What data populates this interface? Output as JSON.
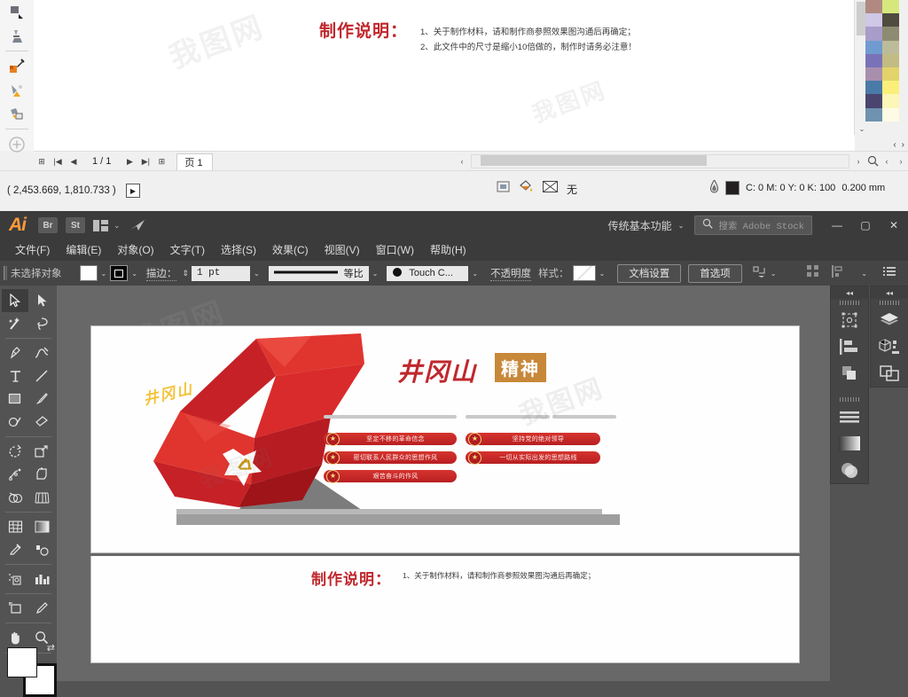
{
  "corel": {
    "toolbox": [
      {
        "name": "shadow-tool",
        "label": "阴影工具"
      },
      {
        "name": "transparency-tool",
        "label": "透明度工具"
      },
      {
        "name": "color-eyedropper-tool",
        "label": "颜色滴管工具"
      },
      {
        "name": "interactive-fill-tool",
        "label": "交互式填充工具"
      },
      {
        "name": "smart-fill-tool",
        "label": "智能填充工具"
      },
      {
        "name": "add-tool-icon",
        "label": "添加工具"
      }
    ],
    "document_note": {
      "title": "制作说明：",
      "line1": "1、关于制作材料，请和制作商参照效果图沟通后再确定；",
      "line2": "2、此文件中的尺寸是缩小10倍做的，制作时请务必注意！"
    },
    "page_nav": {
      "add_page_start": "add-page-icon",
      "first": "first-page-icon",
      "prev": "prev-page-icon",
      "counter": "1 / 1",
      "next": "next-page-icon",
      "last": "last-page-icon",
      "add_page_end": "add-page-icon",
      "tab_label": "页 1"
    },
    "status": {
      "coords": "( 2,453.669, 1,810.733 )",
      "coords_button": "expand-coords-icon",
      "fill_none_label": "无",
      "outline_color": "C: 0 M: 0 Y: 0 K: 100",
      "outline_width": "0.200 mm",
      "outline_swatch_hex": "#231f20"
    },
    "palette": {
      "col1": [
        "#b08a80",
        "#cfc8e6",
        "#a89cc8",
        "#6f9bd1",
        "#7a72b8",
        "#a98fae",
        "#4a7aa8",
        "#49456e",
        "#6f92ae"
      ],
      "col2": [
        "#d6e87d",
        "#4f4b3e",
        "#8d8c72",
        "#bdbc9a",
        "#c2bb84",
        "#e3d36a",
        "#fbef7a",
        "#fdf6b8",
        "#fdfbe4"
      ]
    }
  },
  "ai": {
    "title_bar": {
      "logo": "Ai",
      "bridge": "Br",
      "stock": "St",
      "arrange_icon": "arrange-documents-icon",
      "chevron": "chevron-down-icon",
      "cc_icon": "creative-cloud-icon",
      "workspace": "传统基本功能",
      "search_placeholder": "搜索 Adobe Stock",
      "minimize": "—",
      "maximize": "▢",
      "close": "✕"
    },
    "menus": [
      "文件(F)",
      "编辑(E)",
      "对象(O)",
      "文字(T)",
      "选择(S)",
      "效果(C)",
      "视图(V)",
      "窗口(W)",
      "帮助(H)"
    ],
    "control_bar": {
      "selection_label": "未选择对象",
      "fill_swatch_hex": "#ffffff",
      "stroke_label": "描边：",
      "stroke_weight": "1 pt",
      "stroke_profile": "等比",
      "brush_label": "Touch C...",
      "opacity_label": "不透明度",
      "style_label": "样式：",
      "document_setup": "文档设置",
      "preferences": "首选项",
      "align_icon": "align-icon",
      "transform_icon": "transform-icon",
      "menu_icon": "panel-menu-icon"
    },
    "tools": [
      {
        "name": "selection-tool",
        "selected": true
      },
      {
        "name": "direct-selection-tool",
        "selected": false
      },
      {
        "name": "magic-wand-tool",
        "selected": false
      },
      {
        "name": "lasso-tool",
        "selected": false
      },
      {
        "name": "pen-tool",
        "selected": false
      },
      {
        "name": "curvature-tool",
        "selected": false
      },
      {
        "name": "type-tool",
        "selected": false
      },
      {
        "name": "line-segment-tool",
        "selected": false
      },
      {
        "name": "rectangle-tool",
        "selected": false
      },
      {
        "name": "paintbrush-tool",
        "selected": false
      },
      {
        "name": "shaper-tool",
        "selected": false
      },
      {
        "name": "eraser-tool",
        "selected": false
      },
      {
        "name": "rotate-tool",
        "selected": false
      },
      {
        "name": "scale-tool",
        "selected": false
      },
      {
        "name": "width-tool",
        "selected": false
      },
      {
        "name": "free-transform-tool",
        "selected": false
      },
      {
        "name": "shape-builder-tool",
        "selected": false
      },
      {
        "name": "perspective-grid-tool",
        "selected": false
      },
      {
        "name": "mesh-tool",
        "selected": false
      },
      {
        "name": "gradient-tool",
        "selected": false
      },
      {
        "name": "eyedropper-tool",
        "selected": false
      },
      {
        "name": "blend-tool",
        "selected": false
      },
      {
        "name": "symbol-sprayer-tool",
        "selected": false
      },
      {
        "name": "column-graph-tool",
        "selected": false
      },
      {
        "name": "artboard-tool",
        "selected": false
      },
      {
        "name": "slice-tool",
        "selected": false
      },
      {
        "name": "hand-tool",
        "selected": false
      },
      {
        "name": "zoom-tool",
        "selected": false
      }
    ],
    "fill_stroke": {
      "fill_hex": "#ffffff",
      "stroke_hex": "#000000",
      "swap_icon": "swap-fill-stroke-icon"
    },
    "panels_left": [
      "transform-panel-icon",
      "align-panel-icon",
      "pathfinder-panel-icon",
      "stroke-panel-icon",
      "gradient-panel-icon",
      "transparency-panel-icon"
    ],
    "panels_right": [
      "layers-panel-icon",
      "symbols-panel-icon",
      "artboards-panel-icon"
    ],
    "artwork": {
      "gold_text": "井冈山",
      "title_text": "井冈山",
      "badge_text": "精神",
      "pills_left": [
        "坚定不移的革命信念",
        "密切联系人民群众的思想作风",
        "艰苦奋斗的作风"
      ],
      "pills_right": [
        "坚持党的绝对领导",
        "一切从实际出发的思想路线"
      ],
      "star_glyph": "★",
      "emblem": "party-emblem-icon"
    },
    "note_bottom": {
      "title": "制作说明：",
      "line1": "1、关于制作材料，请和制作商参照效果图沟通后再确定；"
    }
  },
  "watermark": "我图网"
}
